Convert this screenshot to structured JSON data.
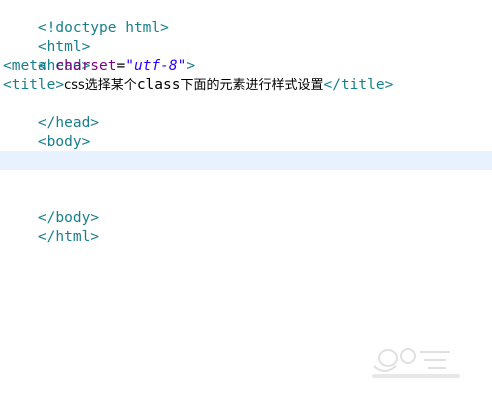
{
  "code": {
    "line1": "<!doctype html>",
    "line2": "<html>",
    "line3": "<head>",
    "line4_open": "<meta ",
    "line4_attr": "charset",
    "line4_eq": "=",
    "line4_val": "\"utf-8\"",
    "line4_close": ">",
    "line5_open": "<title>",
    "line5_text1": "css选择某个",
    "line5_text2": "class",
    "line5_text3": "下面的元素进行样式设置",
    "line5_close": "</title>",
    "line6": "</head>",
    "line7": "<body>",
    "line10": "</body>",
    "line11": "</html>"
  },
  "colors": {
    "tag": "#17808c",
    "attribute": "#7f007f",
    "value": "#2a00ff",
    "current_line": "#e8f2fe"
  }
}
